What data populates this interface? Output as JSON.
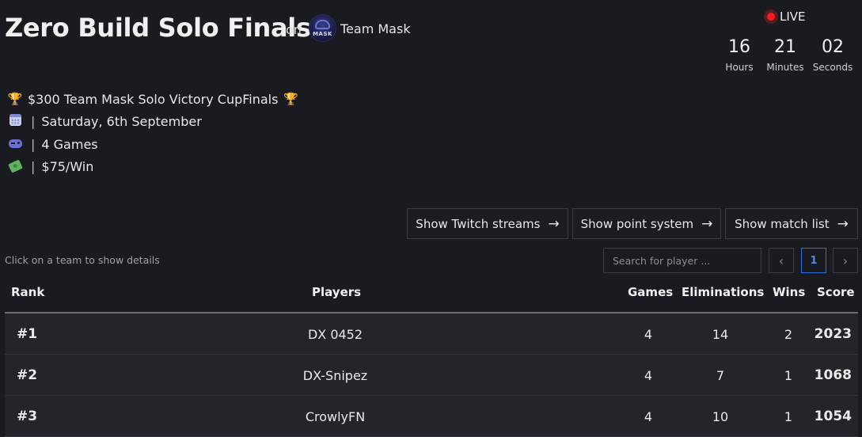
{
  "event": {
    "title": "Zero Build Solo Finals",
    "on_label": "on",
    "organizer": "Team Mask",
    "organizer_logo_text": "MASK"
  },
  "status": {
    "live_label": "LIVE",
    "live_color": "#ff1a1a",
    "countdown": [
      {
        "value": "16",
        "label": "Hours"
      },
      {
        "value": "21",
        "label": "Minutes"
      },
      {
        "value": "02",
        "label": "Seconds"
      }
    ]
  },
  "info": {
    "rows": [
      {
        "icon": "trophy-icon",
        "text": "$300 Team Mask Solo Victory CupFinals"
      },
      {
        "icon": "calendar-icon",
        "separator": "|",
        "text": "Saturday, 6th September"
      },
      {
        "icon": "gamepad-icon",
        "separator": "|",
        "text": "4 Games"
      },
      {
        "icon": "money-icon",
        "separator": "|",
        "text": "$75/Win"
      }
    ]
  },
  "actions": {
    "twitch": "Show Twitch streams",
    "points": "Show point system",
    "matches": "Show match list"
  },
  "leaderboard": {
    "hint": "Click on a team to show details",
    "search_placeholder": "Search for player ...",
    "page": "1",
    "columns": {
      "rank": "Rank",
      "players": "Players",
      "games": "Games",
      "eliminations": "Eliminations",
      "wins": "Wins",
      "score": "Score"
    },
    "rows": [
      {
        "rank": "#1",
        "player": "DX 0452",
        "games": "4",
        "eliminations": "14",
        "wins": "2",
        "score": "2023"
      },
      {
        "rank": "#2",
        "player": "DX-Snipez",
        "games": "4",
        "eliminations": "7",
        "wins": "1",
        "score": "1068"
      },
      {
        "rank": "#3",
        "player": "CrowlyFN",
        "games": "4",
        "eliminations": "10",
        "wins": "1",
        "score": "1054"
      }
    ]
  },
  "colors": {
    "background": "#1a1b20",
    "row_background": "#24252b",
    "accent": "#2e6fd8",
    "trophy": "#e0a11a"
  }
}
